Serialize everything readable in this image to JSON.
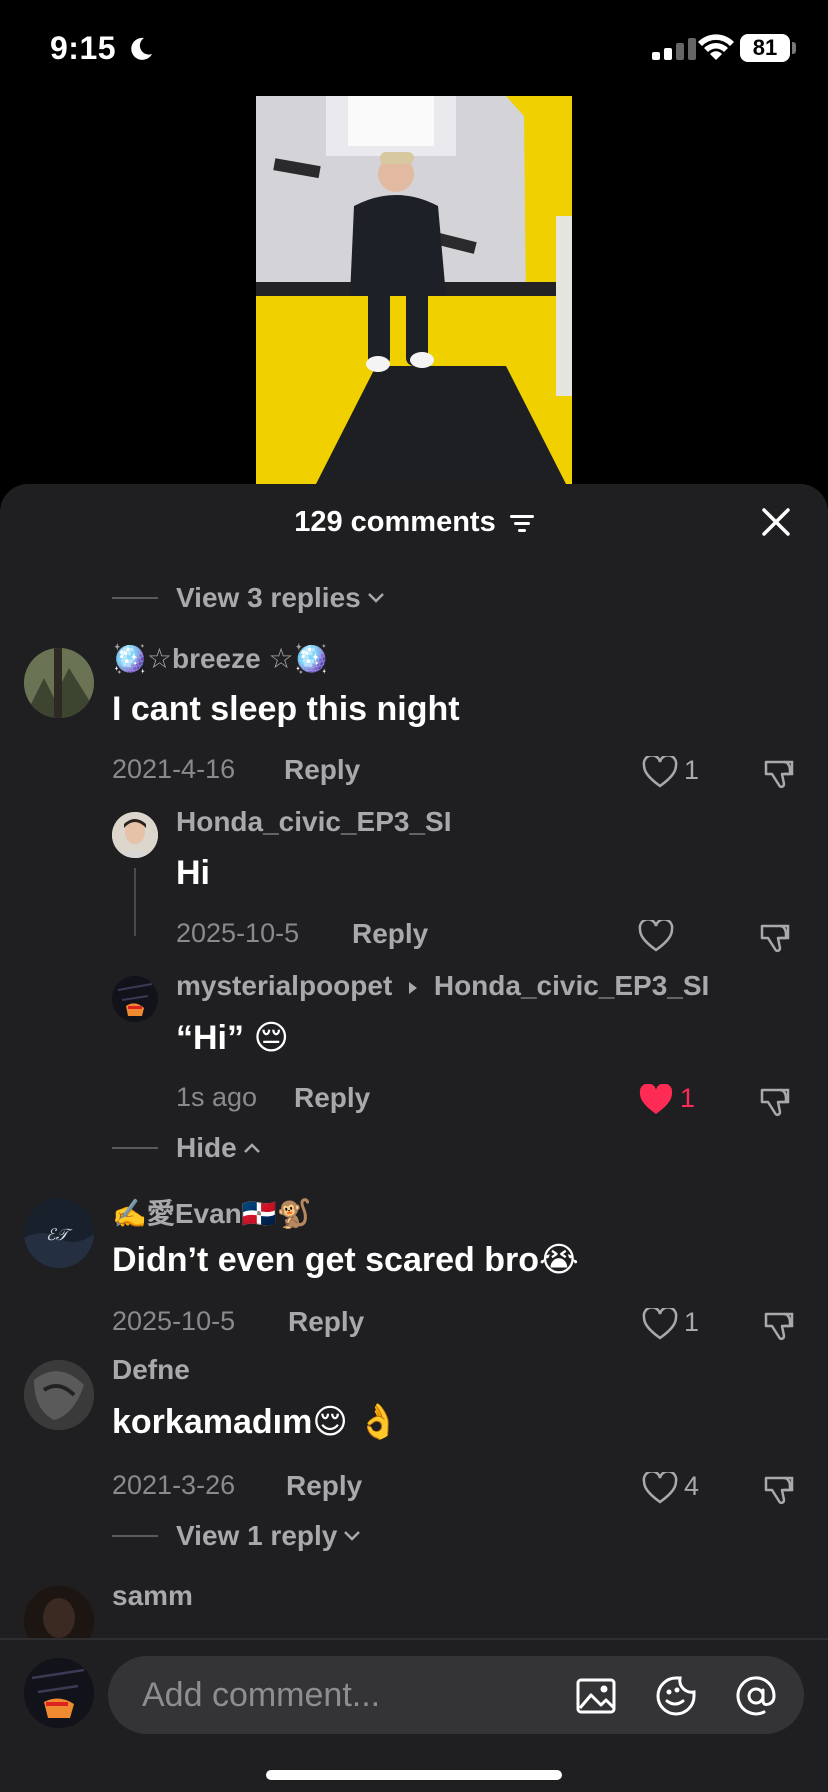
{
  "status_bar": {
    "time": "9:15",
    "battery": "81"
  },
  "sheet": {
    "title": "129 comments"
  },
  "top_view_replies": "View 3 replies",
  "comments": [
    {
      "user": "🪩☆breeze ☆🪩",
      "text": "I cant sleep this night",
      "date": "2021-4-16",
      "reply_label": "Reply",
      "likes": "1",
      "replies": [
        {
          "user": "Honda_civic_EP3_SI",
          "text": "Hi",
          "date": "2025-10-5",
          "reply_label": "Reply",
          "likes": ""
        },
        {
          "user": "mysterialpoopet",
          "reply_to": "Honda_civic_EP3_SI",
          "text": "“Hi”  😔",
          "date": "1s ago",
          "reply_label": "Reply",
          "likes": "1",
          "liked": true
        }
      ],
      "hide_label": "Hide"
    },
    {
      "user": "✍️愛Evan🇩🇴🐒",
      "text": "Didn’t even get scared bro😭",
      "date": "2025-10-5",
      "reply_label": "Reply",
      "likes": "1"
    },
    {
      "user": "Defne",
      "text": "korkamadım😌 👌",
      "date": "2021-3-26",
      "reply_label": "Reply",
      "likes": "4",
      "view_replies": "View 1 reply"
    },
    {
      "user": "samm"
    }
  ],
  "composer": {
    "placeholder": "Add comment..."
  },
  "colors": {
    "sheet_bg": "#1f1f21",
    "liked": "#fe2c55",
    "muted": "#a9a9ab"
  },
  "icons": [
    "moon-icon",
    "signal-icon",
    "wifi-icon",
    "filter-icon",
    "close-icon",
    "heart-icon",
    "dislike-icon",
    "chevron-down-icon",
    "chevron-up-icon",
    "image-icon",
    "emoji-icon",
    "mention-icon"
  ]
}
